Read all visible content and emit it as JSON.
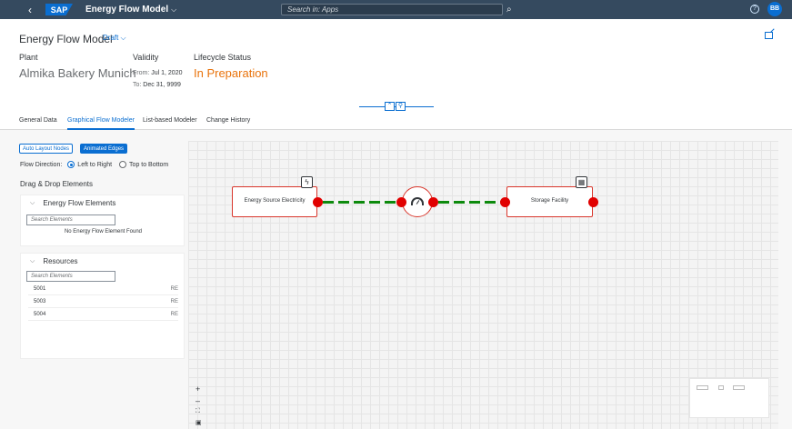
{
  "shell": {
    "back": "‹",
    "logo": "SAP",
    "app_title": "Energy Flow Model",
    "app_title_chevron": "⌵",
    "search_placeholder": "Search in: Apps",
    "search_icon": "⌕",
    "help": "?",
    "avatar": "BB"
  },
  "header": {
    "title": "Energy Flow Model",
    "variant": "Draft ⌵",
    "plant_label": "Plant",
    "plant_value": "Almika Bakery Munich",
    "validity_label": "Validity",
    "from_label": "From:",
    "from_value": "Jul 1, 2020",
    "to_label": "To:",
    "to_value": "Dec 31, 9999",
    "status_label": "Lifecycle Status",
    "status_value": "In Preparation",
    "collapse_icon": "⌃",
    "pin_icon": "⚲"
  },
  "tabs": [
    "General Data",
    "Graphical Flow Modeler",
    "List-based Modeler",
    "Change History"
  ],
  "toolbar": {
    "auto_layout": "Auto Layout Nodes",
    "animated_edges": "Animated Edges"
  },
  "flow_direction": {
    "label": "Flow Direction:",
    "option1": "Left to Right",
    "option2": "Top to Bottom",
    "selected": "Left to Right"
  },
  "dnd": {
    "title": "Drag & Drop Elements",
    "energy_panel": {
      "chevron": "⌵",
      "title": "Energy Flow Elements",
      "search_placeholder": "Search Elements",
      "empty_message": "No Energy Flow Element Found"
    },
    "resources_panel": {
      "chevron": "⌵",
      "title": "Resources",
      "search_placeholder": "Search Elements",
      "rows": [
        {
          "id": "5001",
          "code": "RE"
        },
        {
          "id": "5003",
          "code": "RE"
        },
        {
          "id": "5004",
          "code": "RE"
        }
      ]
    }
  },
  "canvas": {
    "source_node": {
      "label": "Energy Source Electricity",
      "icon": "ϟ"
    },
    "storage_node": {
      "label": "Storage Facility",
      "icon": "▦"
    },
    "zoom": {
      "in": "+",
      "out": "–",
      "fit": "⛶",
      "overview": "▣"
    }
  },
  "colors": {
    "shell": "#354a5f",
    "accent": "#0a6ed1",
    "status": "#e9730c",
    "port": "#e10000",
    "edge": "#0d8a0d"
  }
}
